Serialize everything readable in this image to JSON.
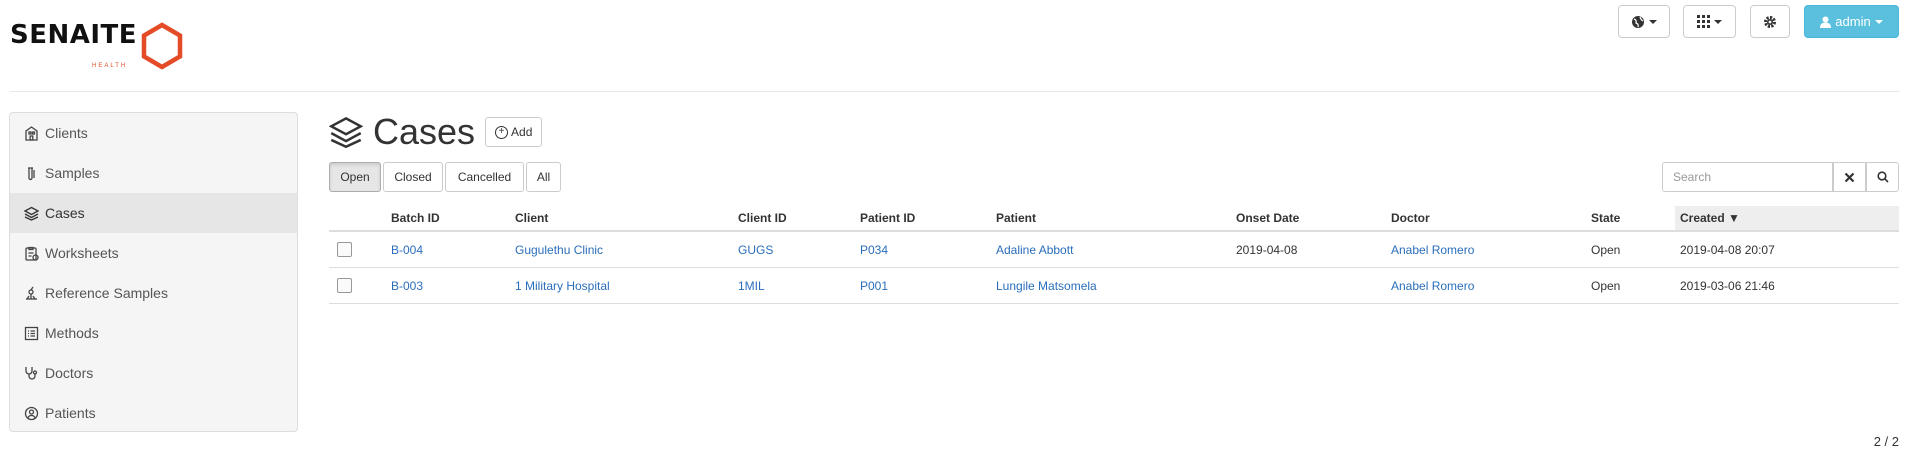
{
  "brand": {
    "name": "SENAITE",
    "sub": "HEALTH",
    "accent": "#e34c26"
  },
  "topbar": {
    "language_icon": "globe-icon",
    "apps_icon": "grid-icon",
    "settings_icon": "gear-icon",
    "user_label": "admin"
  },
  "sidebar": {
    "items": [
      {
        "label": "Clients",
        "icon": "building-icon"
      },
      {
        "label": "Samples",
        "icon": "test-tube-icon"
      },
      {
        "label": "Cases",
        "icon": "layers-icon"
      },
      {
        "label": "Worksheets",
        "icon": "clipboard-icon"
      },
      {
        "label": "Reference Samples",
        "icon": "microscope-icon"
      },
      {
        "label": "Methods",
        "icon": "list-icon"
      },
      {
        "label": "Doctors",
        "icon": "stethoscope-icon"
      },
      {
        "label": "Patients",
        "icon": "user-circle-icon"
      }
    ],
    "active": "Cases"
  },
  "main": {
    "title": "Cases",
    "add_label": "Add",
    "filters": [
      "Open",
      "Closed",
      "Cancelled",
      "All"
    ],
    "active_filter": "Open",
    "search": {
      "placeholder": "Search"
    },
    "table": {
      "columns": [
        "",
        "Batch ID",
        "Client",
        "Client ID",
        "Patient ID",
        "Patient",
        "Onset Date",
        "Doctor",
        "State",
        "Created ▼"
      ],
      "rows": [
        {
          "batch_id": "B-004",
          "client": "Gugulethu Clinic",
          "client_id": "GUGS",
          "patient_id": "P034",
          "patient": "Adaline Abbott",
          "onset_date": "2019-04-08",
          "doctor": "Anabel Romero",
          "state": "Open",
          "created": "2019-04-08 20:07"
        },
        {
          "batch_id": "B-003",
          "client": "1 Military Hospital",
          "client_id": "1MIL",
          "patient_id": "P001",
          "patient": "Lungile Matsomela",
          "onset_date": "",
          "doctor": "Anabel Romero",
          "state": "Open",
          "created": "2019-03-06 21:46"
        }
      ]
    },
    "count": "2 / 2"
  }
}
